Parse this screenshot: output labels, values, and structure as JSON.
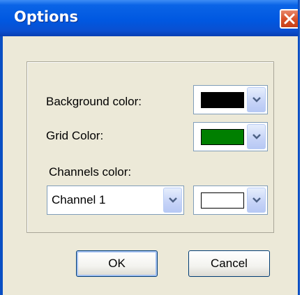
{
  "window": {
    "title": "Options"
  },
  "options": {
    "background_color": {
      "label": "Background color:",
      "swatch": "#000000"
    },
    "grid_color": {
      "label": "Grid Color:",
      "swatch": "#007f00"
    },
    "channels_color": {
      "label": "Channels color:",
      "channel_selected": "Channel 1",
      "swatch": "#ffffff"
    }
  },
  "buttons": {
    "ok": "OK",
    "cancel": "Cancel"
  },
  "icons": {
    "close": "close-icon",
    "dropdown": "chevron-down-icon"
  },
  "colors": {
    "titlebar": "#0058e1",
    "dialog_bg": "#ece9d8",
    "close": "#d9532c"
  }
}
